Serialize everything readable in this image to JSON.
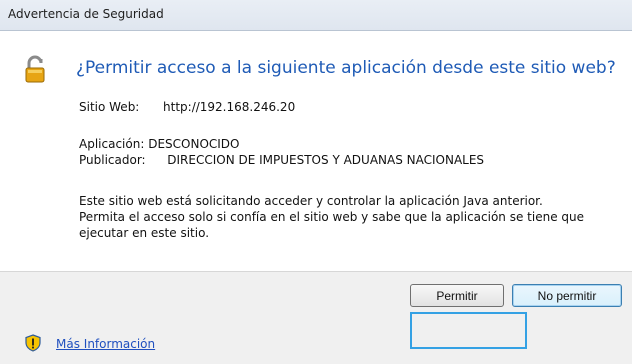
{
  "window": {
    "title": "Advertencia de Seguridad"
  },
  "dialog": {
    "heading": "¿Permitir acceso a la siguiente aplicación desde este sitio web?",
    "site_label": "Sitio Web:",
    "site_value": "http://192.168.246.20",
    "app_label": "Aplicación:",
    "app_value": "DESCONOCIDO",
    "publisher_label": "Publicador:",
    "publisher_value": "DIRECCION DE IMPUESTOS Y ADUANAS NACIONALES",
    "message_lines": [
      "Este sitio web está solicitando acceder y controlar la aplicación Java anterior.",
      "Permita el acceso solo si confía en el sitio web y sabe que la aplicación se tiene que",
      "ejecutar en este sitio."
    ]
  },
  "buttons": {
    "allow": "Permitir",
    "deny": "No permitir"
  },
  "footer": {
    "more_info_link": "Más Información"
  },
  "icons": {
    "lock": "lock-icon",
    "shield": "shield-warning-icon"
  },
  "colors": {
    "heading": "#1f5bb6",
    "link": "#1f4fbf",
    "focus_highlight": "#34a1e4"
  }
}
